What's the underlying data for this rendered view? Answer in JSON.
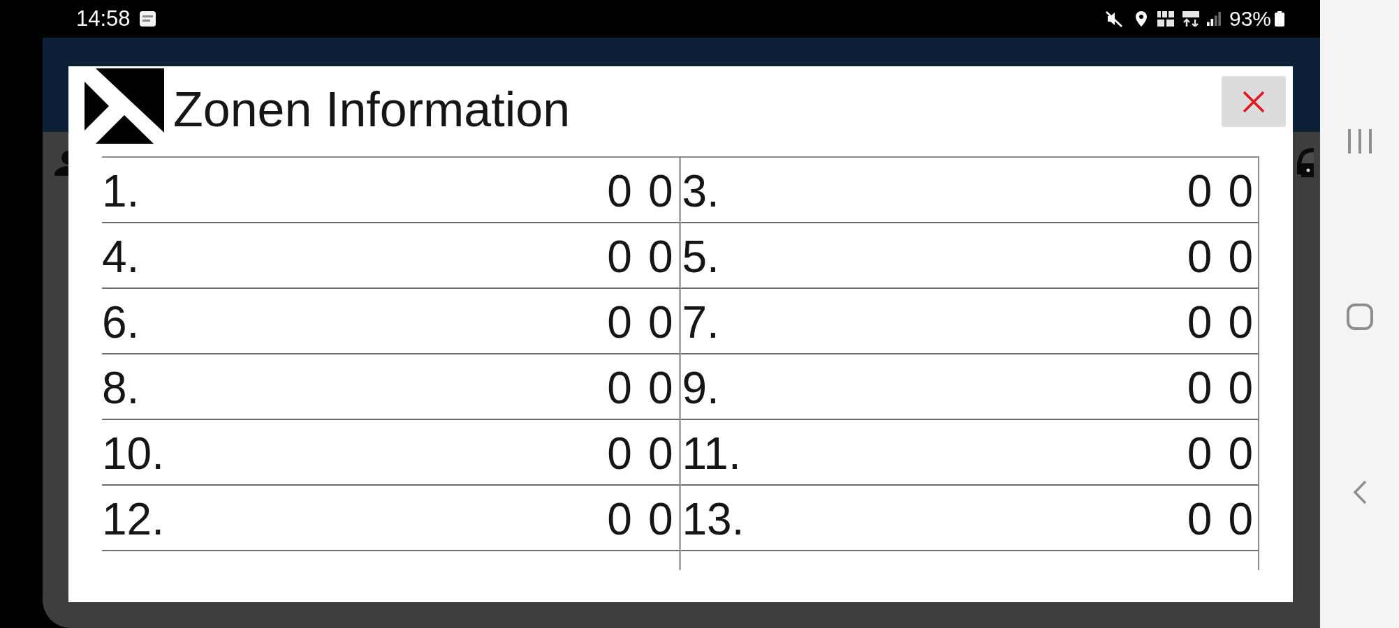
{
  "status_bar": {
    "time": "14:58",
    "battery": "93%"
  },
  "dialog": {
    "title": "Zonen Information",
    "rows": [
      {
        "cells": [
          {
            "number": "1.",
            "values": [
              "0",
              "0"
            ]
          },
          {
            "number": "3.",
            "values": [
              "0",
              "0"
            ]
          }
        ]
      },
      {
        "cells": [
          {
            "number": "4.",
            "values": [
              "0",
              "0"
            ]
          },
          {
            "number": "5.",
            "values": [
              "0",
              "0"
            ]
          }
        ]
      },
      {
        "cells": [
          {
            "number": "6.",
            "values": [
              "0",
              "0"
            ]
          },
          {
            "number": "7.",
            "values": [
              "0",
              "0"
            ]
          }
        ]
      },
      {
        "cells": [
          {
            "number": "8.",
            "values": [
              "0",
              "0"
            ]
          },
          {
            "number": "9.",
            "values": [
              "0",
              "0"
            ]
          }
        ]
      },
      {
        "cells": [
          {
            "number": "10.",
            "values": [
              "0",
              "0"
            ]
          },
          {
            "number": "11.",
            "values": [
              "0",
              "0"
            ]
          }
        ]
      },
      {
        "cells": [
          {
            "number": "12.",
            "values": [
              "0",
              "0"
            ]
          },
          {
            "number": "13.",
            "values": [
              "0",
              "0"
            ]
          }
        ]
      }
    ]
  }
}
